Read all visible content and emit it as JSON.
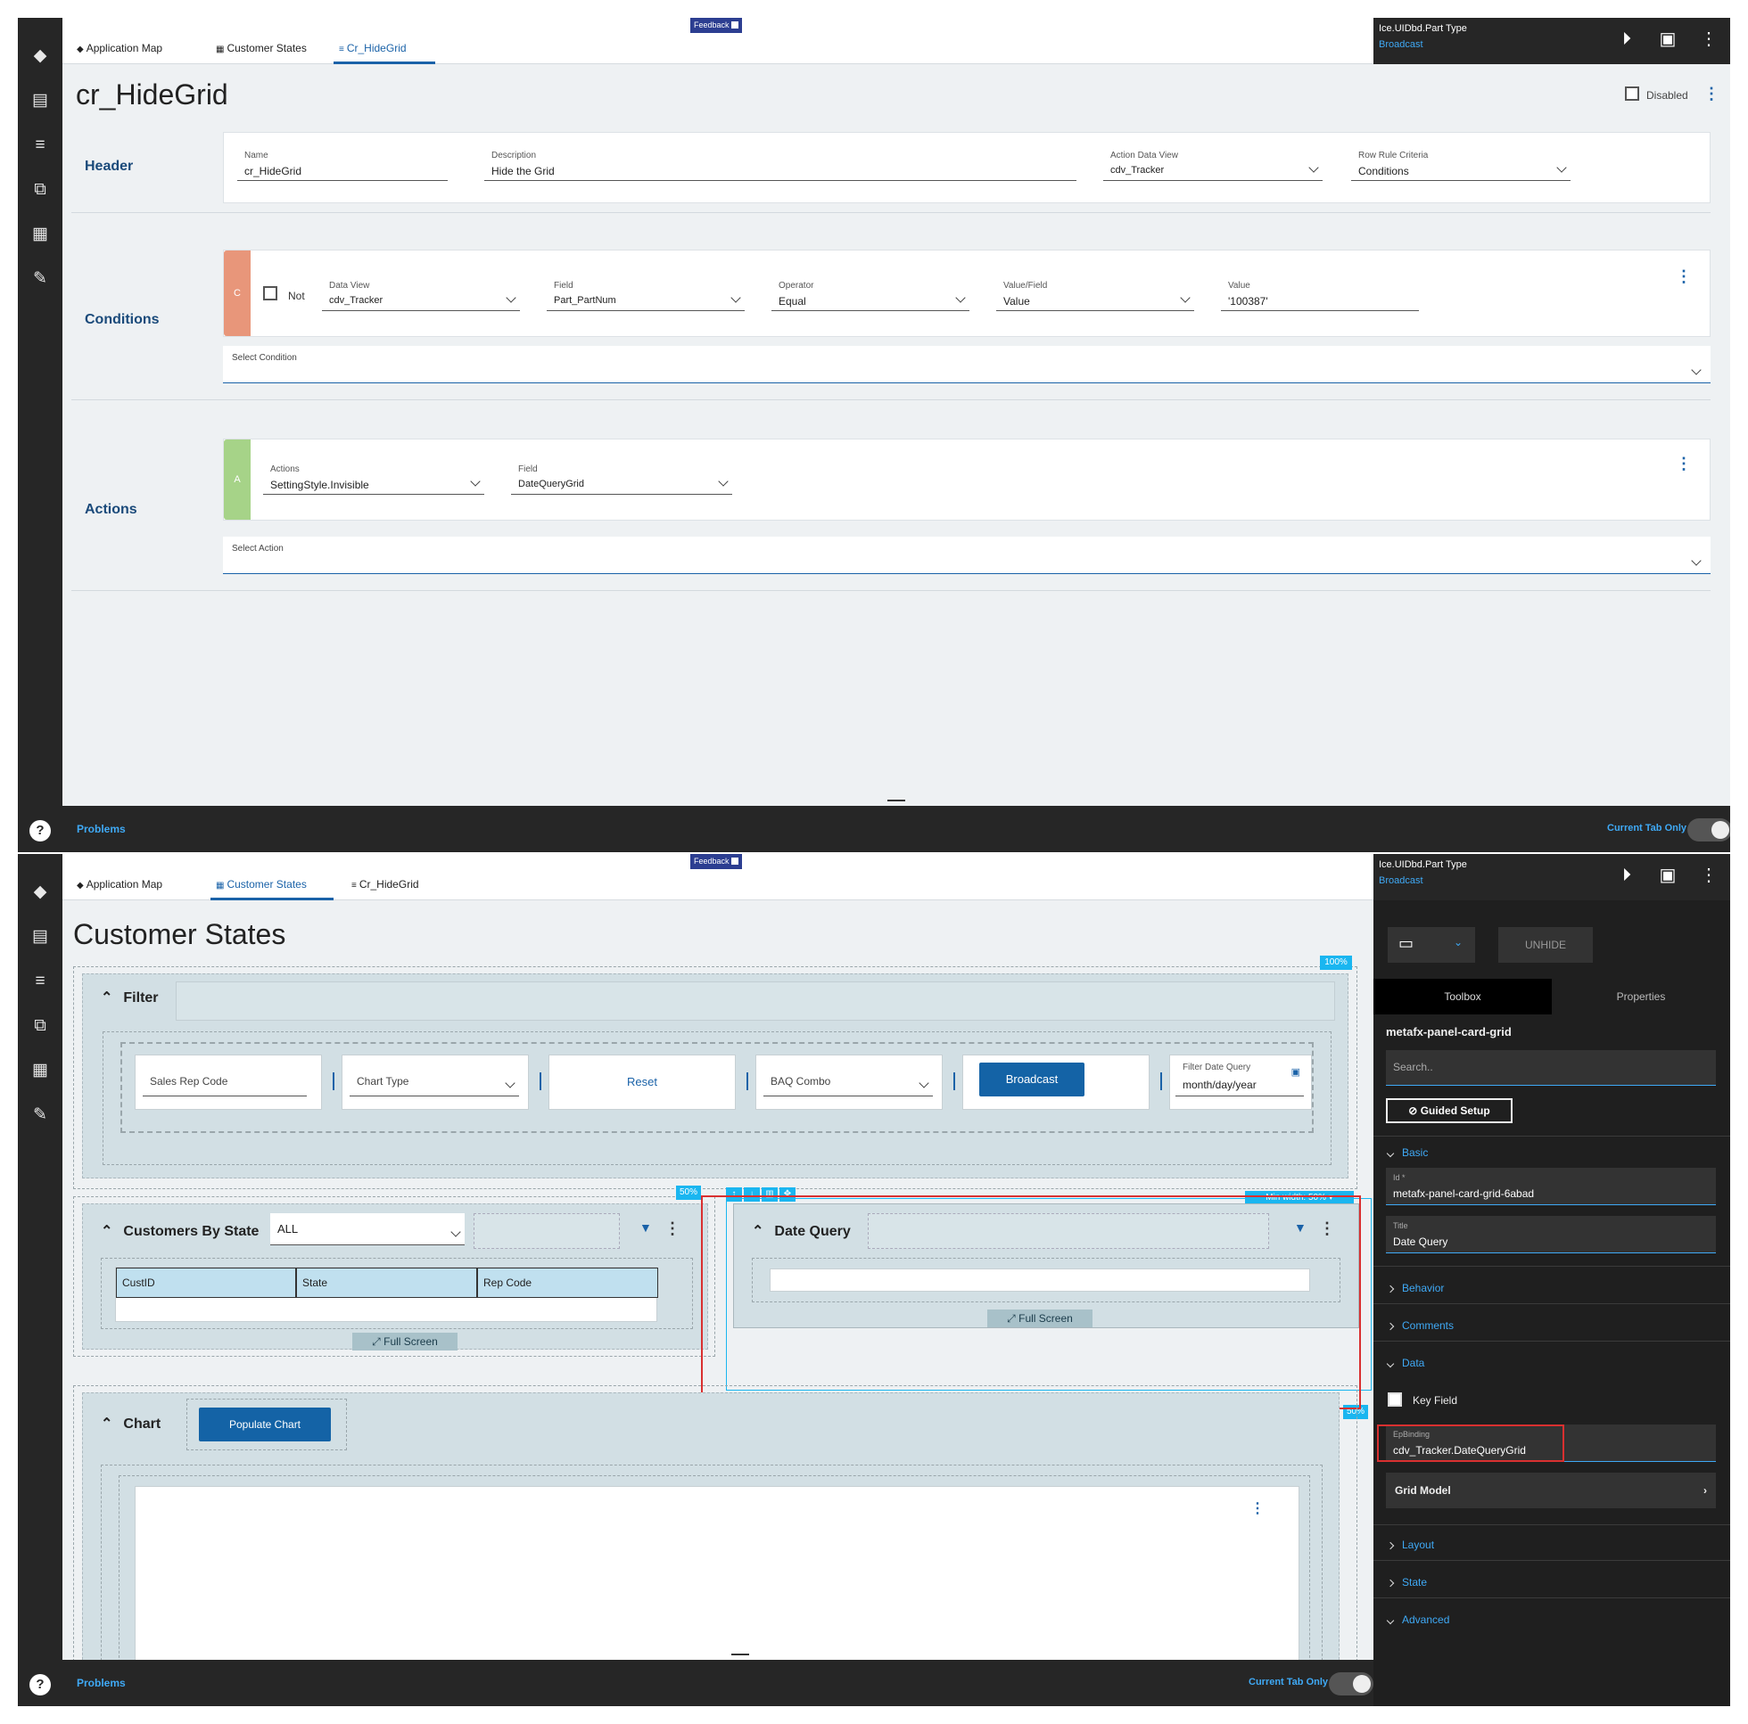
{
  "screen1": {
    "tabs": [
      {
        "label": "Application Map"
      },
      {
        "label": "Customer States"
      },
      {
        "label": "Cr_HideGrid"
      }
    ],
    "feedback": "Feedback",
    "right_panel": {
      "title": "Ice.UIDbd.Part Type",
      "subtitle": "Broadcast"
    },
    "page_title": "cr_HideGrid",
    "disabled_label": "Disabled",
    "header": {
      "label": "Header",
      "name": {
        "label": "Name",
        "value": "cr_HideGrid"
      },
      "description": {
        "label": "Description",
        "value": "Hide the Grid"
      },
      "action_data_view": {
        "label": "Action Data View",
        "value": "cdv_Tracker"
      },
      "row_rule_criteria": {
        "label": "Row Rule Criteria",
        "value": "Conditions"
      }
    },
    "conditions": {
      "label": "Conditions",
      "tag": "C",
      "not_label": "Not",
      "data_view": {
        "label": "Data View",
        "value": "cdv_Tracker"
      },
      "field": {
        "label": "Field",
        "value": "Part_PartNum"
      },
      "operator": {
        "label": "Operator",
        "value": "Equal"
      },
      "value_field": {
        "label": "Value/Field",
        "value": "Value"
      },
      "value": {
        "label": "Value",
        "value": "'100387'"
      },
      "select_condition": "Select Condition"
    },
    "actions": {
      "label": "Actions",
      "tag": "A",
      "actions_field": {
        "label": "Actions",
        "value": "SettingStyle.Invisible"
      },
      "field": {
        "label": "Field",
        "value": "DateQueryGrid"
      },
      "select_action": "Select Action"
    },
    "bottom": {
      "problems": "Problems",
      "current_tab_only": "Current Tab Only"
    }
  },
  "screen2": {
    "tabs": [
      {
        "label": "Application Map"
      },
      {
        "label": "Customer States"
      },
      {
        "label": "Cr_HideGrid"
      }
    ],
    "feedback": "Feedback",
    "right_panel": {
      "title": "Ice.UIDbd.Part Type",
      "subtitle": "Broadcast"
    },
    "page_title": "Customer States",
    "filter": {
      "title": "Filter",
      "pct": "100%",
      "sales_rep_code": "Sales Rep Code",
      "chart_type": "Chart Type",
      "reset": "Reset",
      "baq_combo": "BAQ Combo",
      "broadcast": "Broadcast",
      "filter_date_label": "Filter Date Query",
      "filter_date_value": "month/day/year"
    },
    "customers": {
      "title": "Customers By State",
      "pct": "50%",
      "select_value": "ALL",
      "columns": [
        "CustID",
        "State",
        "Rep Code"
      ],
      "full_screen": "Full Screen"
    },
    "date_query": {
      "title": "Date Query",
      "min_width": "Min width: 50%",
      "pct": "50%",
      "full_screen": "Full Screen"
    },
    "chart": {
      "title": "Chart",
      "populate": "Populate Chart"
    },
    "side": {
      "unhide": "UNHIDE",
      "toolbox": "Toolbox",
      "properties": "Properties",
      "component": "metafx-panel-card-grid",
      "search_placeholder": "Search..",
      "guided_setup": "Guided Setup",
      "basic": "Basic",
      "id_label": "Id *",
      "id_value": "metafx-panel-card-grid-6abad",
      "title_label": "Title",
      "title_value": "Date Query",
      "behavior": "Behavior",
      "comments": "Comments",
      "data": "Data",
      "key_field": "Key Field",
      "epbinding_label": "EpBinding",
      "epbinding_value": "cdv_Tracker.DateQueryGrid",
      "grid_model": "Grid Model",
      "layout": "Layout",
      "state": "State",
      "advanced": "Advanced"
    },
    "bottom": {
      "problems": "Problems",
      "current_tab_only": "Current Tab Only"
    }
  },
  "colors": {
    "accent": "#1a62a8",
    "highlight": "#d93030",
    "condition_tag": "#e8967a",
    "action_tag": "#a6d388"
  }
}
